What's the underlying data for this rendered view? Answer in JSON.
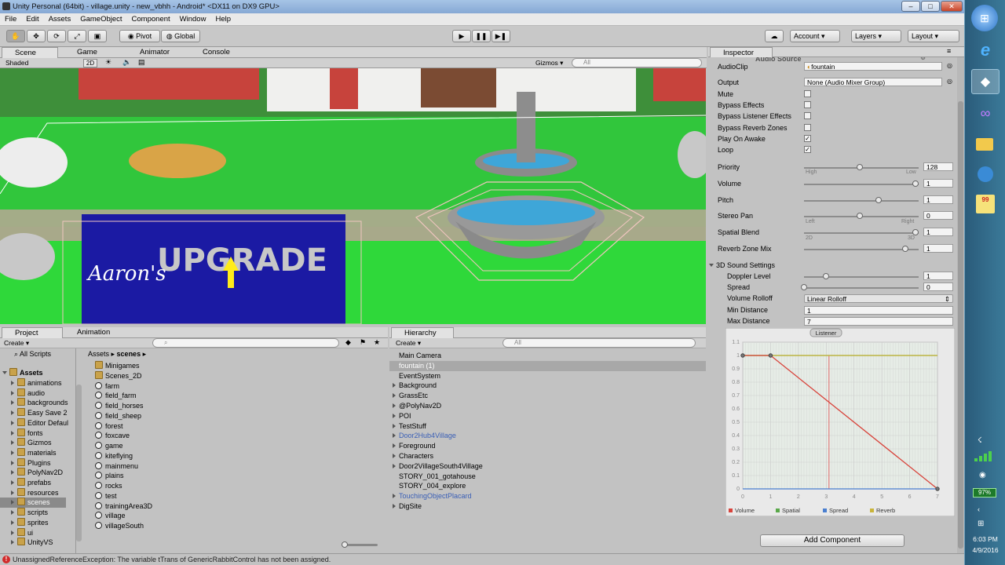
{
  "window": {
    "title": "Unity Personal (64bit) - village.unity - new_vbhh - Android* <DX11 on DX9 GPU>",
    "minimize": "–",
    "maximize": "□",
    "close": "✕"
  },
  "menu": [
    "File",
    "Edit",
    "Assets",
    "GameObject",
    "Component",
    "Window",
    "Help"
  ],
  "toolbar": {
    "pivot": "Pivot",
    "global": "Global",
    "account": "Account",
    "layers": "Layers",
    "layout": "Layout"
  },
  "scene_tabs": [
    "Scene",
    "Game",
    "Animator",
    "Console"
  ],
  "scene_bar": {
    "shading": "Shaded",
    "mode_2d": "2D",
    "gizmos": "Gizmos",
    "search_placeholder": "All"
  },
  "scene_art": {
    "sign_text": "UPGRADE",
    "sign_script": "Aaron's"
  },
  "project": {
    "tabs": [
      "Project",
      "Animation"
    ],
    "create": "Create",
    "favorites": "All Scripts",
    "assets_root": "Assets",
    "breadcrumb_root": "Assets",
    "breadcrumb_current": "scenes",
    "folders": [
      "animations",
      "audio",
      "backgrounds",
      "Easy Save 2",
      "Editor Defaul",
      "fonts",
      "Gizmos",
      "materials",
      "Plugins",
      "PolyNav2D",
      "prefabs",
      "resources",
      "scenes",
      "scripts",
      "sprites",
      "ui",
      "UnityVS"
    ],
    "selected_folder": "scenes",
    "content_folders": [
      "Minigames",
      "Scenes_2D"
    ],
    "content_scenes": [
      "farm",
      "field_farm",
      "field_horses",
      "field_sheep",
      "forest",
      "foxcave",
      "game",
      "kiteflying",
      "mainmenu",
      "plains",
      "rocks",
      "test",
      "trainingArea3D",
      "village",
      "villageSouth"
    ]
  },
  "hierarchy": {
    "tab": "Hierarchy",
    "create": "Create",
    "search_placeholder": "All",
    "items": [
      {
        "name": "Main Camera",
        "arrow": false,
        "prefab": false,
        "selected": false
      },
      {
        "name": "fountain (1)",
        "arrow": false,
        "prefab": false,
        "selected": true
      },
      {
        "name": "EventSystem",
        "arrow": false,
        "prefab": false,
        "selected": false
      },
      {
        "name": "Background",
        "arrow": true,
        "prefab": false,
        "selected": false
      },
      {
        "name": "GrassEtc",
        "arrow": true,
        "prefab": false,
        "selected": false
      },
      {
        "name": "@PolyNav2D",
        "arrow": true,
        "prefab": false,
        "selected": false
      },
      {
        "name": "POI",
        "arrow": true,
        "prefab": false,
        "selected": false
      },
      {
        "name": "TestStuff",
        "arrow": true,
        "prefab": false,
        "selected": false
      },
      {
        "name": "Door2Hub4Village",
        "arrow": true,
        "prefab": true,
        "selected": false
      },
      {
        "name": "Foreground",
        "arrow": true,
        "prefab": false,
        "selected": false
      },
      {
        "name": "Characters",
        "arrow": true,
        "prefab": false,
        "selected": false
      },
      {
        "name": "Door2VillageSouth4Village",
        "arrow": true,
        "prefab": false,
        "selected": false
      },
      {
        "name": "STORY_001_gotahouse",
        "arrow": false,
        "prefab": false,
        "selected": false
      },
      {
        "name": "STORY_004_explore",
        "arrow": false,
        "prefab": false,
        "selected": false
      },
      {
        "name": "TouchingObjectPlacard",
        "arrow": true,
        "prefab": true,
        "selected": false
      },
      {
        "name": "DigSite",
        "arrow": true,
        "prefab": false,
        "selected": false
      }
    ]
  },
  "inspector": {
    "tab": "Inspector",
    "component": "Audio Source",
    "audio_clip_label": "AudioClip",
    "audio_clip_value": "fountain",
    "output_label": "Output",
    "output_value": "None (Audio Mixer Group)",
    "mute": "Mute",
    "bypass_effects": "Bypass Effects",
    "bypass_listener": "Bypass Listener Effects",
    "bypass_reverb": "Bypass Reverb Zones",
    "play_on_awake": "Play On Awake",
    "loop": "Loop",
    "priority_label": "Priority",
    "priority_value": "128",
    "priority_fraction": 0.5,
    "priority_high": "High",
    "priority_low": "Low",
    "volume_label": "Volume",
    "volume_value": "1",
    "volume_fraction": 1,
    "pitch_label": "Pitch",
    "pitch_value": "1",
    "pitch_fraction": 0.67,
    "stereo_label": "Stereo Pan",
    "stereo_value": "0",
    "stereo_fraction": 0.5,
    "stereo_left": "Left",
    "stereo_right": "Right",
    "spatial_label": "Spatial Blend",
    "spatial_value": "1",
    "spatial_fraction": 1,
    "spatial_2d": "2D",
    "spatial_3d": "3D",
    "reverb_label": "Reverb Zone Mix",
    "reverb_value": "1",
    "reverb_fraction": 0.91,
    "sound3d_header": "3D Sound Settings",
    "doppler_label": "Doppler Level",
    "doppler_value": "1",
    "doppler_fraction": 0.2,
    "spread_label": "Spread",
    "spread_value": "0",
    "spread_fraction": 0,
    "rolloff_label": "Volume Rolloff",
    "rolloff_value": "Linear Rolloff",
    "min_label": "Min Distance",
    "min_value": "1",
    "max_label": "Max Distance",
    "max_value": "7",
    "add_component": "Add Component"
  },
  "chart_data": {
    "type": "line",
    "title": "Listener",
    "xlim": [
      0,
      7
    ],
    "ylim": [
      0,
      1.1
    ],
    "xticks": [
      "0",
      "1",
      "2",
      "3",
      "4",
      "5",
      "6",
      "7"
    ],
    "yticks": [
      "0",
      "0.1",
      "0.2",
      "0.3",
      "0.4",
      "0.5",
      "0.6",
      "0.7",
      "0.8",
      "0.9",
      "1",
      "1.1"
    ],
    "listener_x": 3.1,
    "series": [
      {
        "name": "Volume",
        "color": "#d8433b",
        "points": [
          [
            0,
            1
          ],
          [
            1,
            1
          ],
          [
            7,
            0
          ]
        ]
      },
      {
        "name": "Spatial",
        "color": "#5aa84a",
        "points": [
          [
            0,
            1
          ],
          [
            7,
            1
          ]
        ]
      },
      {
        "name": "Spread",
        "color": "#4a7fd0",
        "points": [
          [
            0,
            0
          ],
          [
            7,
            0
          ]
        ]
      },
      {
        "name": "Reverb",
        "color": "#c9b43a",
        "points": [
          [
            0,
            1
          ],
          [
            7,
            1
          ]
        ]
      }
    ]
  },
  "status": {
    "error": "UnassignedReferenceException: The variable tTrans of GenericRabbitControl has not been assigned."
  },
  "taskbar": {
    "battery": "97%",
    "time": "6:03 PM",
    "date": "4/9/2016",
    "badge": "99"
  }
}
